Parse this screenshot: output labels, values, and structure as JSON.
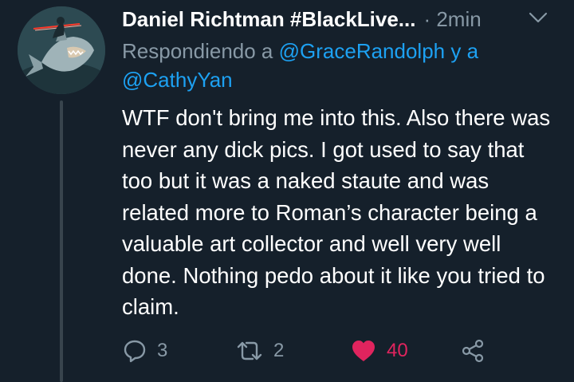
{
  "tweet": {
    "author_name": "Daniel Richtman #BlackLive...",
    "time": "· 2min",
    "reply_prefix": "Respondiendo a",
    "mention_1": "@GraceRandolph",
    "reply_joiner": "y a",
    "mention_2": "@CathyYan",
    "text": "WTF don't bring me into this. Also there was never any dick pics. I got used to say that too but it was a naked staute and was related more to Roman’s character being a valuable art collector and well very well done. Nothing pedo about it like you tried to claim.",
    "actions": {
      "reply_count": "3",
      "retweet_count": "2",
      "like_count": "40"
    }
  },
  "colors": {
    "background": "#15202b",
    "secondary_text": "#8899a6",
    "mention": "#1da1f2",
    "like": "#e0245e",
    "thread_line": "#38444d"
  },
  "icons": [
    "avatar-image",
    "chevron-down-icon",
    "reply-icon",
    "retweet-icon",
    "heart-filled-icon",
    "share-icon"
  ]
}
